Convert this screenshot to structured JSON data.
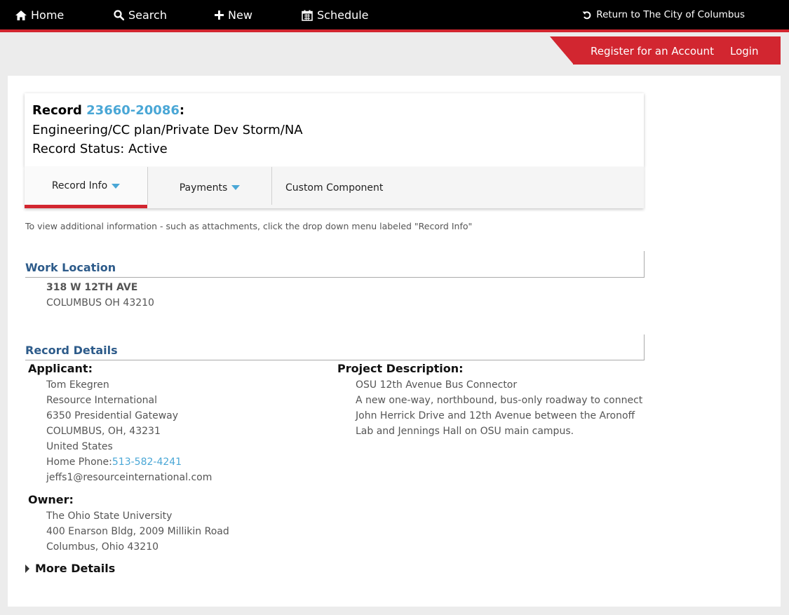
{
  "nav": {
    "home": "Home",
    "search": "Search",
    "new": "New",
    "schedule": "Schedule",
    "return": "Return to The City of Columbus"
  },
  "account": {
    "register": "Register for an Account",
    "login": "Login"
  },
  "record": {
    "label": "Record",
    "id": "23660-20086",
    "colon": ":",
    "type": "Engineering/CC plan/Private Dev Storm/NA",
    "status": "Record Status: Active"
  },
  "tabs": [
    "Record Info",
    "Payments",
    "Custom Component"
  ],
  "hint": "To view additional information - such as attachments, click the drop down menu labeled \"Record Info\"",
  "work_location": {
    "title": "Work Location",
    "line1": "318 W 12TH AVE",
    "line2": "COLUMBUS OH 43210"
  },
  "details": {
    "title": "Record Details",
    "applicant_label": "Applicant:",
    "applicant": [
      "Tom Ekegren",
      "Resource International",
      "6350 Presidential Gateway",
      "COLUMBUS, OH, 43231",
      "United States"
    ],
    "phone_label": "Home Phone:",
    "phone": "513-582-4241",
    "email": "jeffs1@resourceinternational.com",
    "owner_label": "Owner:",
    "owner": [
      "The Ohio State University",
      "400 Enarson Bldg, 2009 Millikin Road",
      "Columbus, Ohio 43210"
    ],
    "project_label": "Project Description:",
    "project": [
      "OSU 12th Avenue Bus Connector",
      "A new one-way, northbound, bus-only roadway to connect",
      "John Herrick Drive and 12th Avenue between the Aronoff",
      "Lab and Jennings Hall on OSU main campus."
    ],
    "more": "More Details"
  }
}
